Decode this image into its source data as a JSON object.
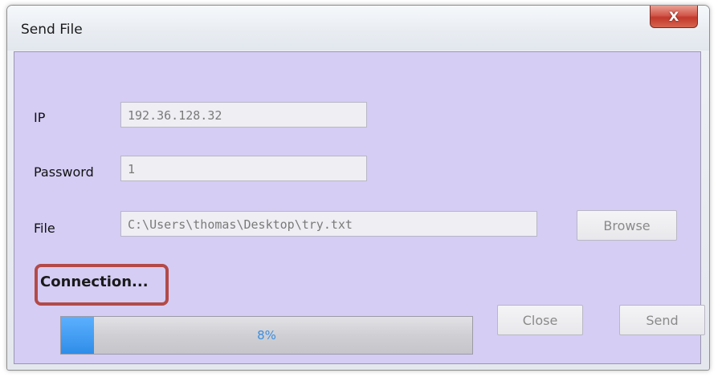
{
  "window": {
    "title": "Send File",
    "close_glyph": "X"
  },
  "form": {
    "ip_label": "IP",
    "ip_value": "192.36.128.32",
    "password_label": "Password",
    "password_value": "1",
    "file_label": "File",
    "file_value": "C:\\Users\\thomas\\Desktop\\try.txt",
    "browse_label": "Browse"
  },
  "status": {
    "text": "Connection...",
    "highlight_color": "#b34a48"
  },
  "progress": {
    "percent": 8,
    "label": "8%",
    "fill_color": "#3b9cf5"
  },
  "actions": {
    "close_label": "Close",
    "send_label": "Send"
  },
  "colors": {
    "client_background": "#d5cdf4"
  }
}
